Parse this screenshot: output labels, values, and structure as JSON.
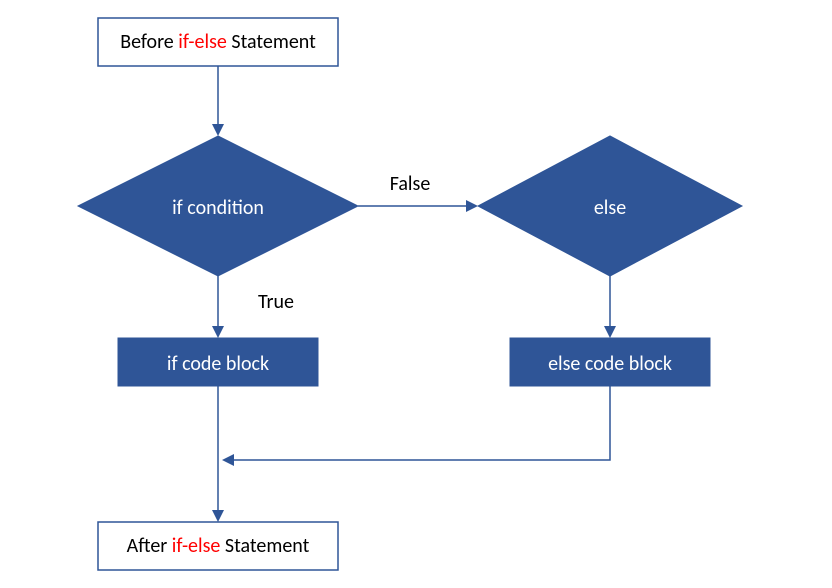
{
  "colors": {
    "primary": "#2F5597",
    "keyword": "#ff0000"
  },
  "nodes": {
    "before": {
      "pre": "Before ",
      "kw": "if-else",
      "post": " Statement"
    },
    "if_condition": "if  condition",
    "else": "else",
    "if_block": "if code block",
    "else_block": "else code block",
    "after": {
      "pre": "After ",
      "kw": "if-else",
      "post": " Statement"
    }
  },
  "edges": {
    "true": "True",
    "false": "False"
  }
}
